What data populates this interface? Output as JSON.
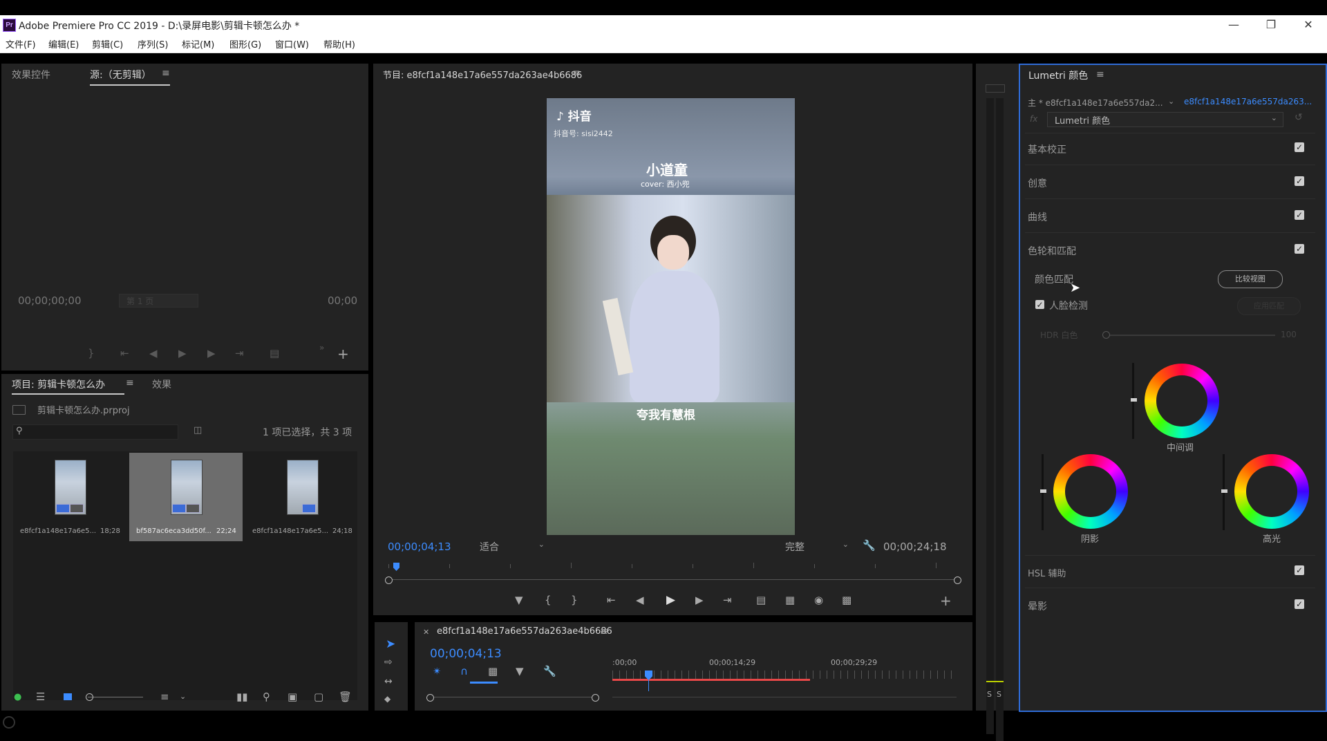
{
  "app": {
    "icon_text": "Pr",
    "title": "Adobe Premiere Pro CC 2019 - D:\\录屏电影\\剪辑卡顿怎么办 *",
    "menus": [
      "文件(F)",
      "编辑(E)",
      "剪辑(C)",
      "序列(S)",
      "标记(M)",
      "图形(G)",
      "窗口(W)",
      "帮助(H)"
    ]
  },
  "source_panel": {
    "tab_effect_controls": "效果控件",
    "tab_source": "源:（无剪辑）",
    "timecode_left": "00;00;00;00",
    "page_select": "第 1 页",
    "timecode_right": "00;00"
  },
  "project_panel": {
    "tab_project": "项目: 剪辑卡顿怎么办",
    "tab_effects": "效果",
    "project_file": "剪辑卡顿怎么办.prproj",
    "selection_count": "1 项已选择，共 3 项",
    "items": [
      {
        "name": "e8fcf1a148e17a6e5...",
        "duration": "18;28",
        "selected": false
      },
      {
        "name": "bf587ac6eca3dd50f...",
        "duration": "22;24",
        "selected": true
      },
      {
        "name": "e8fcf1a148e17a6e5...",
        "duration": "24;18",
        "selected": false
      }
    ]
  },
  "program_monitor": {
    "title": "节目: e8fcf1a148e17a6e557da263ae4b6686",
    "video": {
      "app_logo": "抖音",
      "account": "抖音号: sisi2442",
      "caption_title": "小道童",
      "caption_sub": "cover: 西小兜",
      "subtitle": "夸我有慧根"
    },
    "current_time": "00;00;04;13",
    "zoom": "适合",
    "quality": "完整",
    "duration": "00;00;24;18"
  },
  "timeline": {
    "sequence_name": "e8fcf1a148e17a6e557da263ae4b6686",
    "current_time": "00;00;04;13",
    "ruler": [
      ":00;00",
      "00;00;14;29",
      "00;00;29;29"
    ]
  },
  "audio_meter": {
    "labels": [
      "S",
      "S"
    ]
  },
  "lumetri": {
    "title": "Lumetri 颜色",
    "master_clip": "主 * e8fcf1a148e17a6e557da2...",
    "linked_clip": "e8fcf1a148e17a6e557da263...",
    "fx_label": "fx",
    "effect_select": "Lumetri 颜色",
    "sections": {
      "basic": "基本校正",
      "creative": "创意",
      "curves": "曲线",
      "wheels": "色轮和匹配",
      "hsl": "HSL 辅助",
      "vignette": "晕影"
    },
    "color_match": "颜色匹配",
    "compare_view": "比较视图",
    "face_detect": "人脸检测",
    "apply_match": "应用匹配",
    "hdr_white": "HDR 白色",
    "hdr_value": "100",
    "wheel_midtones": "中间调",
    "wheel_shadows": "阴影",
    "wheel_highlights": "高光"
  },
  "colors": {
    "accent_blue": "#3c8cff",
    "panel_bg": "#232323",
    "highlight_border": "#2f6cd8",
    "timeline_bar": "#e84848"
  }
}
